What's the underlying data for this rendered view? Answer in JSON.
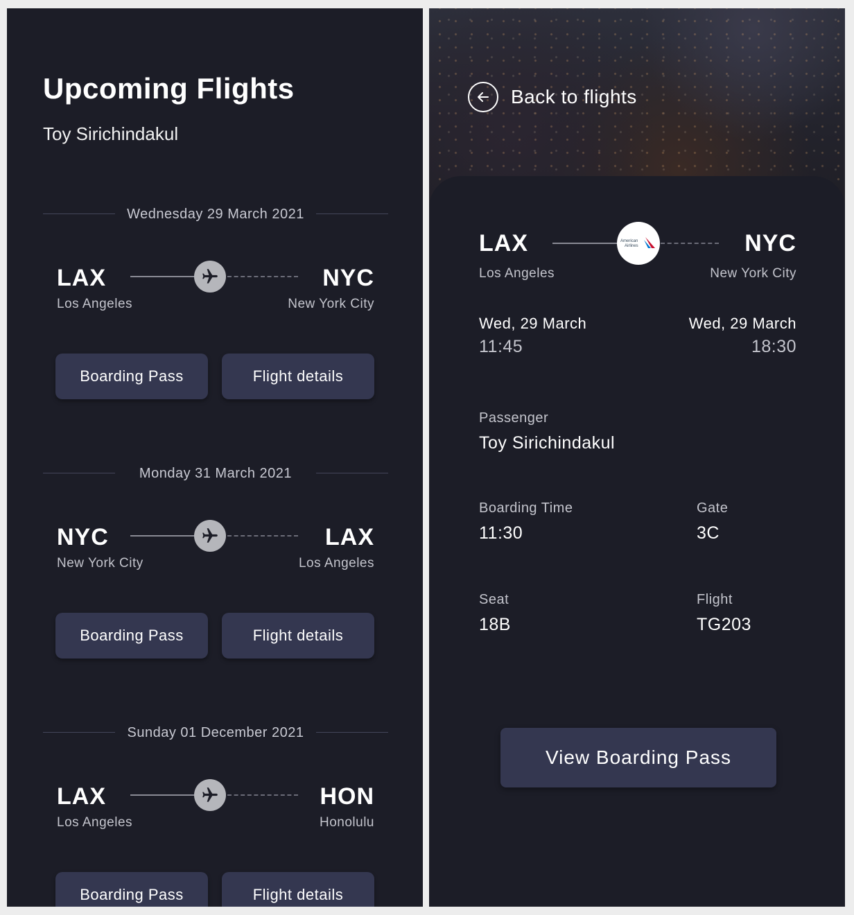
{
  "colors": {
    "background": "#1c1d27",
    "button": "#343750",
    "text": "#ffffff",
    "muted_text": "#c4c5cd",
    "plane_badge": "#b5b6bb"
  },
  "list_screen": {
    "title": "Upcoming Flights",
    "passenger_name": "Toy Sirichindakul",
    "flights": [
      {
        "date": "Wednesday 29 March 2021",
        "from_code": "LAX",
        "from_city": "Los Angeles",
        "to_code": "NYC",
        "to_city": "New York City",
        "boarding_pass_label": "Boarding Pass",
        "flight_details_label": "Flight details",
        "icon": "airplane-icon"
      },
      {
        "date": "Monday 31 March 2021",
        "from_code": "NYC",
        "from_city": "New York City",
        "to_code": "LAX",
        "to_city": "Los Angeles",
        "boarding_pass_label": "Boarding Pass",
        "flight_details_label": "Flight details",
        "icon": "airplane-icon"
      },
      {
        "date": "Sunday 01 December 2021",
        "from_code": "LAX",
        "from_city": "Los Angeles",
        "to_code": "HON",
        "to_city": "Honolulu",
        "boarding_pass_label": "Boarding Pass",
        "flight_details_label": "Flight details",
        "icon": "airplane-icon"
      }
    ]
  },
  "detail_screen": {
    "back_label": "Back to flights",
    "back_icon": "arrow-left-circle-icon",
    "airline_logo": "American Airlines",
    "from_code": "LAX",
    "from_city": "Los Angeles",
    "to_code": "NYC",
    "to_city": "New York City",
    "departure_date": "Wed, 29 March",
    "departure_time": "11:45",
    "arrival_date": "Wed, 29 March",
    "arrival_time": "18:30",
    "passenger_label": "Passenger",
    "passenger_value": "Toy Sirichindakul",
    "boarding_time_label": "Boarding Time",
    "boarding_time_value": "11:30",
    "gate_label": "Gate",
    "gate_value": "3C",
    "seat_label": "Seat",
    "seat_value": "18B",
    "flight_label": "Flight",
    "flight_value": "TG203",
    "view_boarding_pass_label": "View Boarding Pass"
  }
}
